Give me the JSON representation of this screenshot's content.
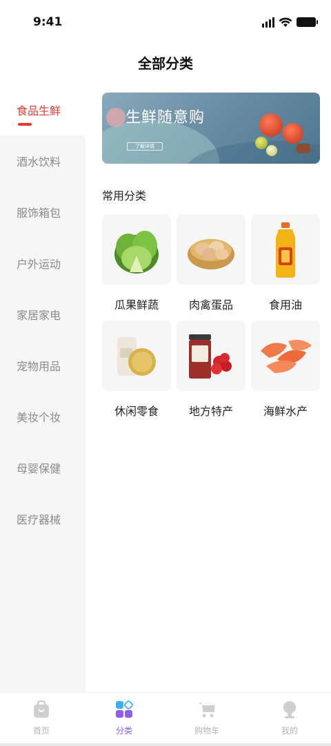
{
  "status": {
    "time": "9:41"
  },
  "header": {
    "title": "全部分类"
  },
  "sidebar": {
    "items": [
      {
        "label": "食品生鲜",
        "active": true
      },
      {
        "label": "酒水饮料",
        "active": false
      },
      {
        "label": "服饰箱包",
        "active": false
      },
      {
        "label": "户外运动",
        "active": false
      },
      {
        "label": "家居家电",
        "active": false
      },
      {
        "label": "宠物用品",
        "active": false
      },
      {
        "label": "美妆个妆",
        "active": false
      },
      {
        "label": "母婴保健",
        "active": false
      },
      {
        "label": "医疗器械",
        "active": false
      }
    ]
  },
  "banner": {
    "title": "生鲜随意购",
    "button_label": "了解详情"
  },
  "section": {
    "title": "常用分类"
  },
  "categories": [
    {
      "label": "瓜果鲜蔬",
      "icon": "lettuce-icon"
    },
    {
      "label": "肉禽蛋品",
      "icon": "eggs-basket-icon"
    },
    {
      "label": "食用油",
      "icon": "oil-bottle-icon"
    },
    {
      "label": "休闲零食",
      "icon": "snack-jar-icon"
    },
    {
      "label": "地方特产",
      "icon": "goji-jar-icon"
    },
    {
      "label": "海鲜水产",
      "icon": "shrimp-icon"
    }
  ],
  "tabbar": {
    "items": [
      {
        "label": "首页",
        "icon": "home-bag-icon",
        "active": false
      },
      {
        "label": "分类",
        "icon": "category-grid-icon",
        "active": true
      },
      {
        "label": "购物车",
        "icon": "cart-icon",
        "active": false
      },
      {
        "label": "我的",
        "icon": "profile-icon",
        "active": false
      }
    ]
  },
  "colors": {
    "accent": "#e8392b",
    "tab_active": "#8f5cf0",
    "inactive": "#b5b5b5"
  }
}
